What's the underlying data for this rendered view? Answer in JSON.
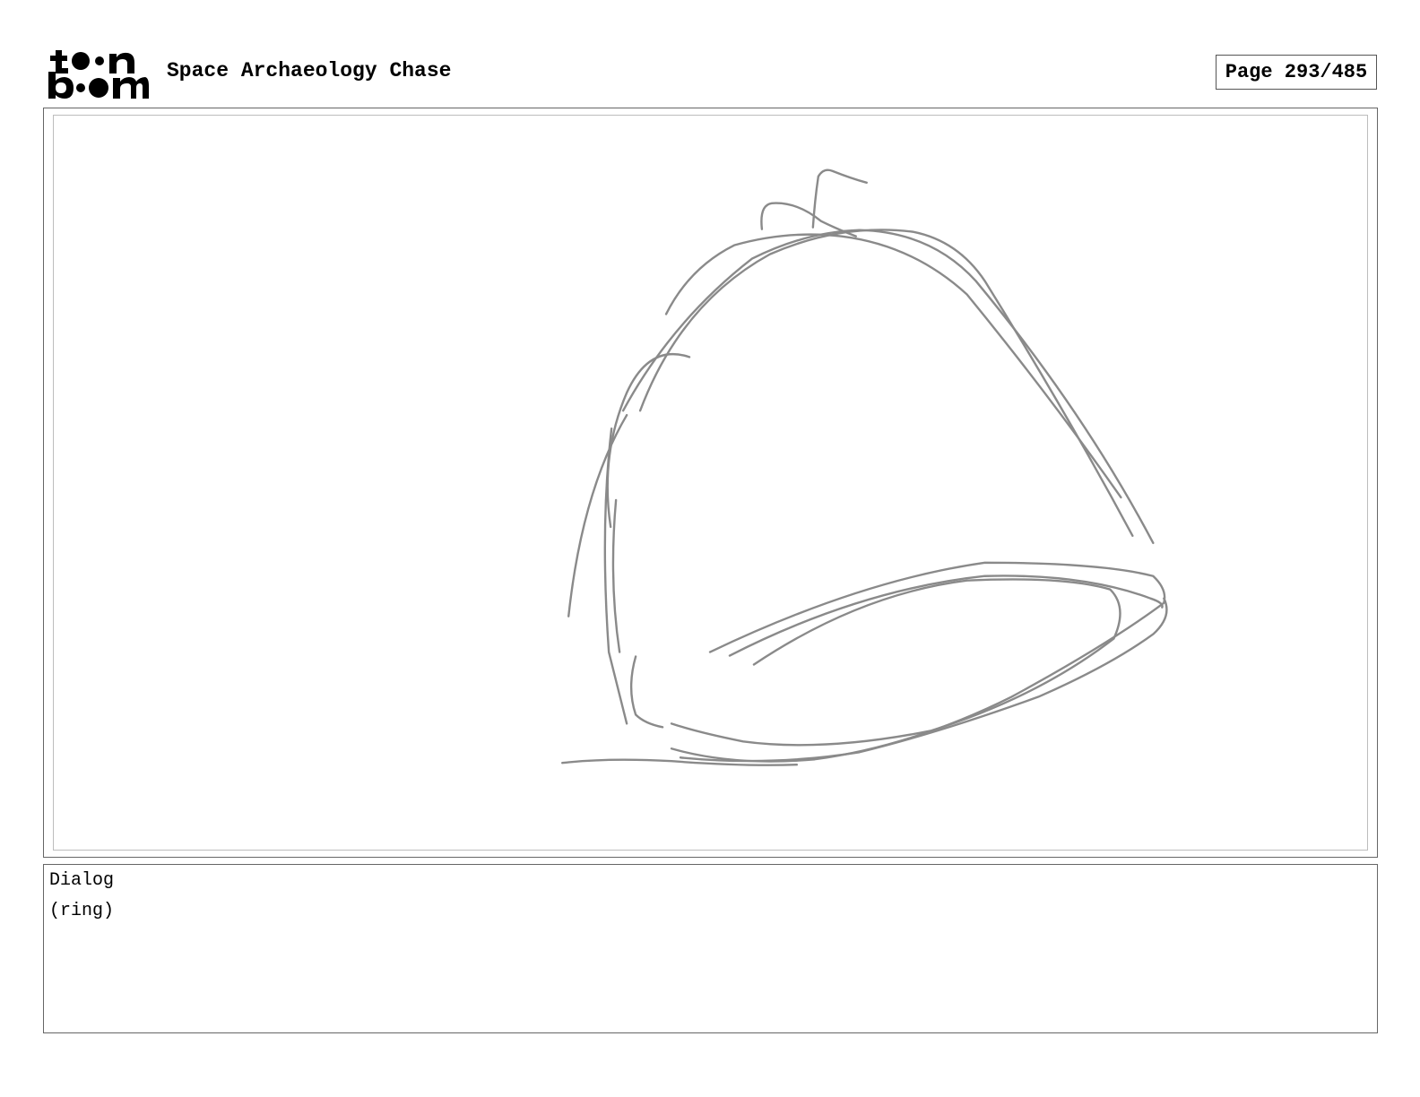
{
  "header": {
    "logo_icon": "toon-boom-logo",
    "logo_lettering": "toon boom",
    "project_title": "Space Archaeology Chase",
    "page_counter": "Page 293/485"
  },
  "panel": {
    "sketch_icon": "hat-sketch-drawing",
    "stroke_color": "#8a8a8a"
  },
  "dialog": {
    "label": "Dialog",
    "text": "(ring)"
  }
}
